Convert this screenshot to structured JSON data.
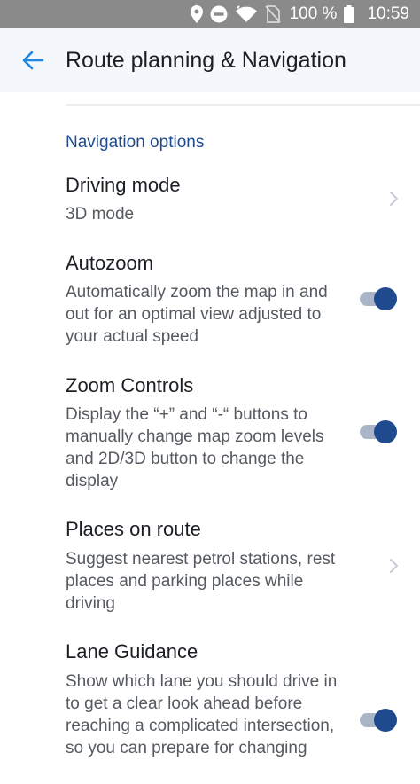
{
  "status_bar": {
    "icons": [
      "location-pin-icon",
      "do-not-disturb-icon",
      "wifi-icon",
      "no-sim-icon",
      "battery-icon"
    ],
    "battery": "100 %",
    "time": "10:59"
  },
  "app_bar": {
    "back_icon": "arrow-left-icon",
    "title": "Route planning & Navigation"
  },
  "section": {
    "header": "Navigation options"
  },
  "settings": [
    {
      "title": "Driving mode",
      "description": "3D mode",
      "control": "chevron"
    },
    {
      "title": "Autozoom",
      "description": "Automatically zoom the map in and out for an optimal view adjusted to your actual speed",
      "control": "toggle",
      "enabled": true
    },
    {
      "title": "Zoom Controls",
      "description": "Display the “+” and “-“ buttons to manually change map zoom levels and 2D/3D button to change the display",
      "control": "toggle",
      "enabled": true
    },
    {
      "title": "Places on route",
      "description": "Suggest nearest petrol stations, rest places and parking places while driving",
      "control": "chevron"
    },
    {
      "title": "Lane Guidance",
      "description": "Show which lane you should drive in to get a clear look ahead before reaching a complicated intersection, so you can prepare for changing",
      "control": "toggle",
      "enabled": true
    }
  ],
  "colors": {
    "accent": "#1f4a8e",
    "back_arrow": "#1e88e5",
    "toggle_track": "#aab6c8",
    "app_bar_bg": "#f4f7fb",
    "status_bar_bg": "#8a8a8a"
  }
}
